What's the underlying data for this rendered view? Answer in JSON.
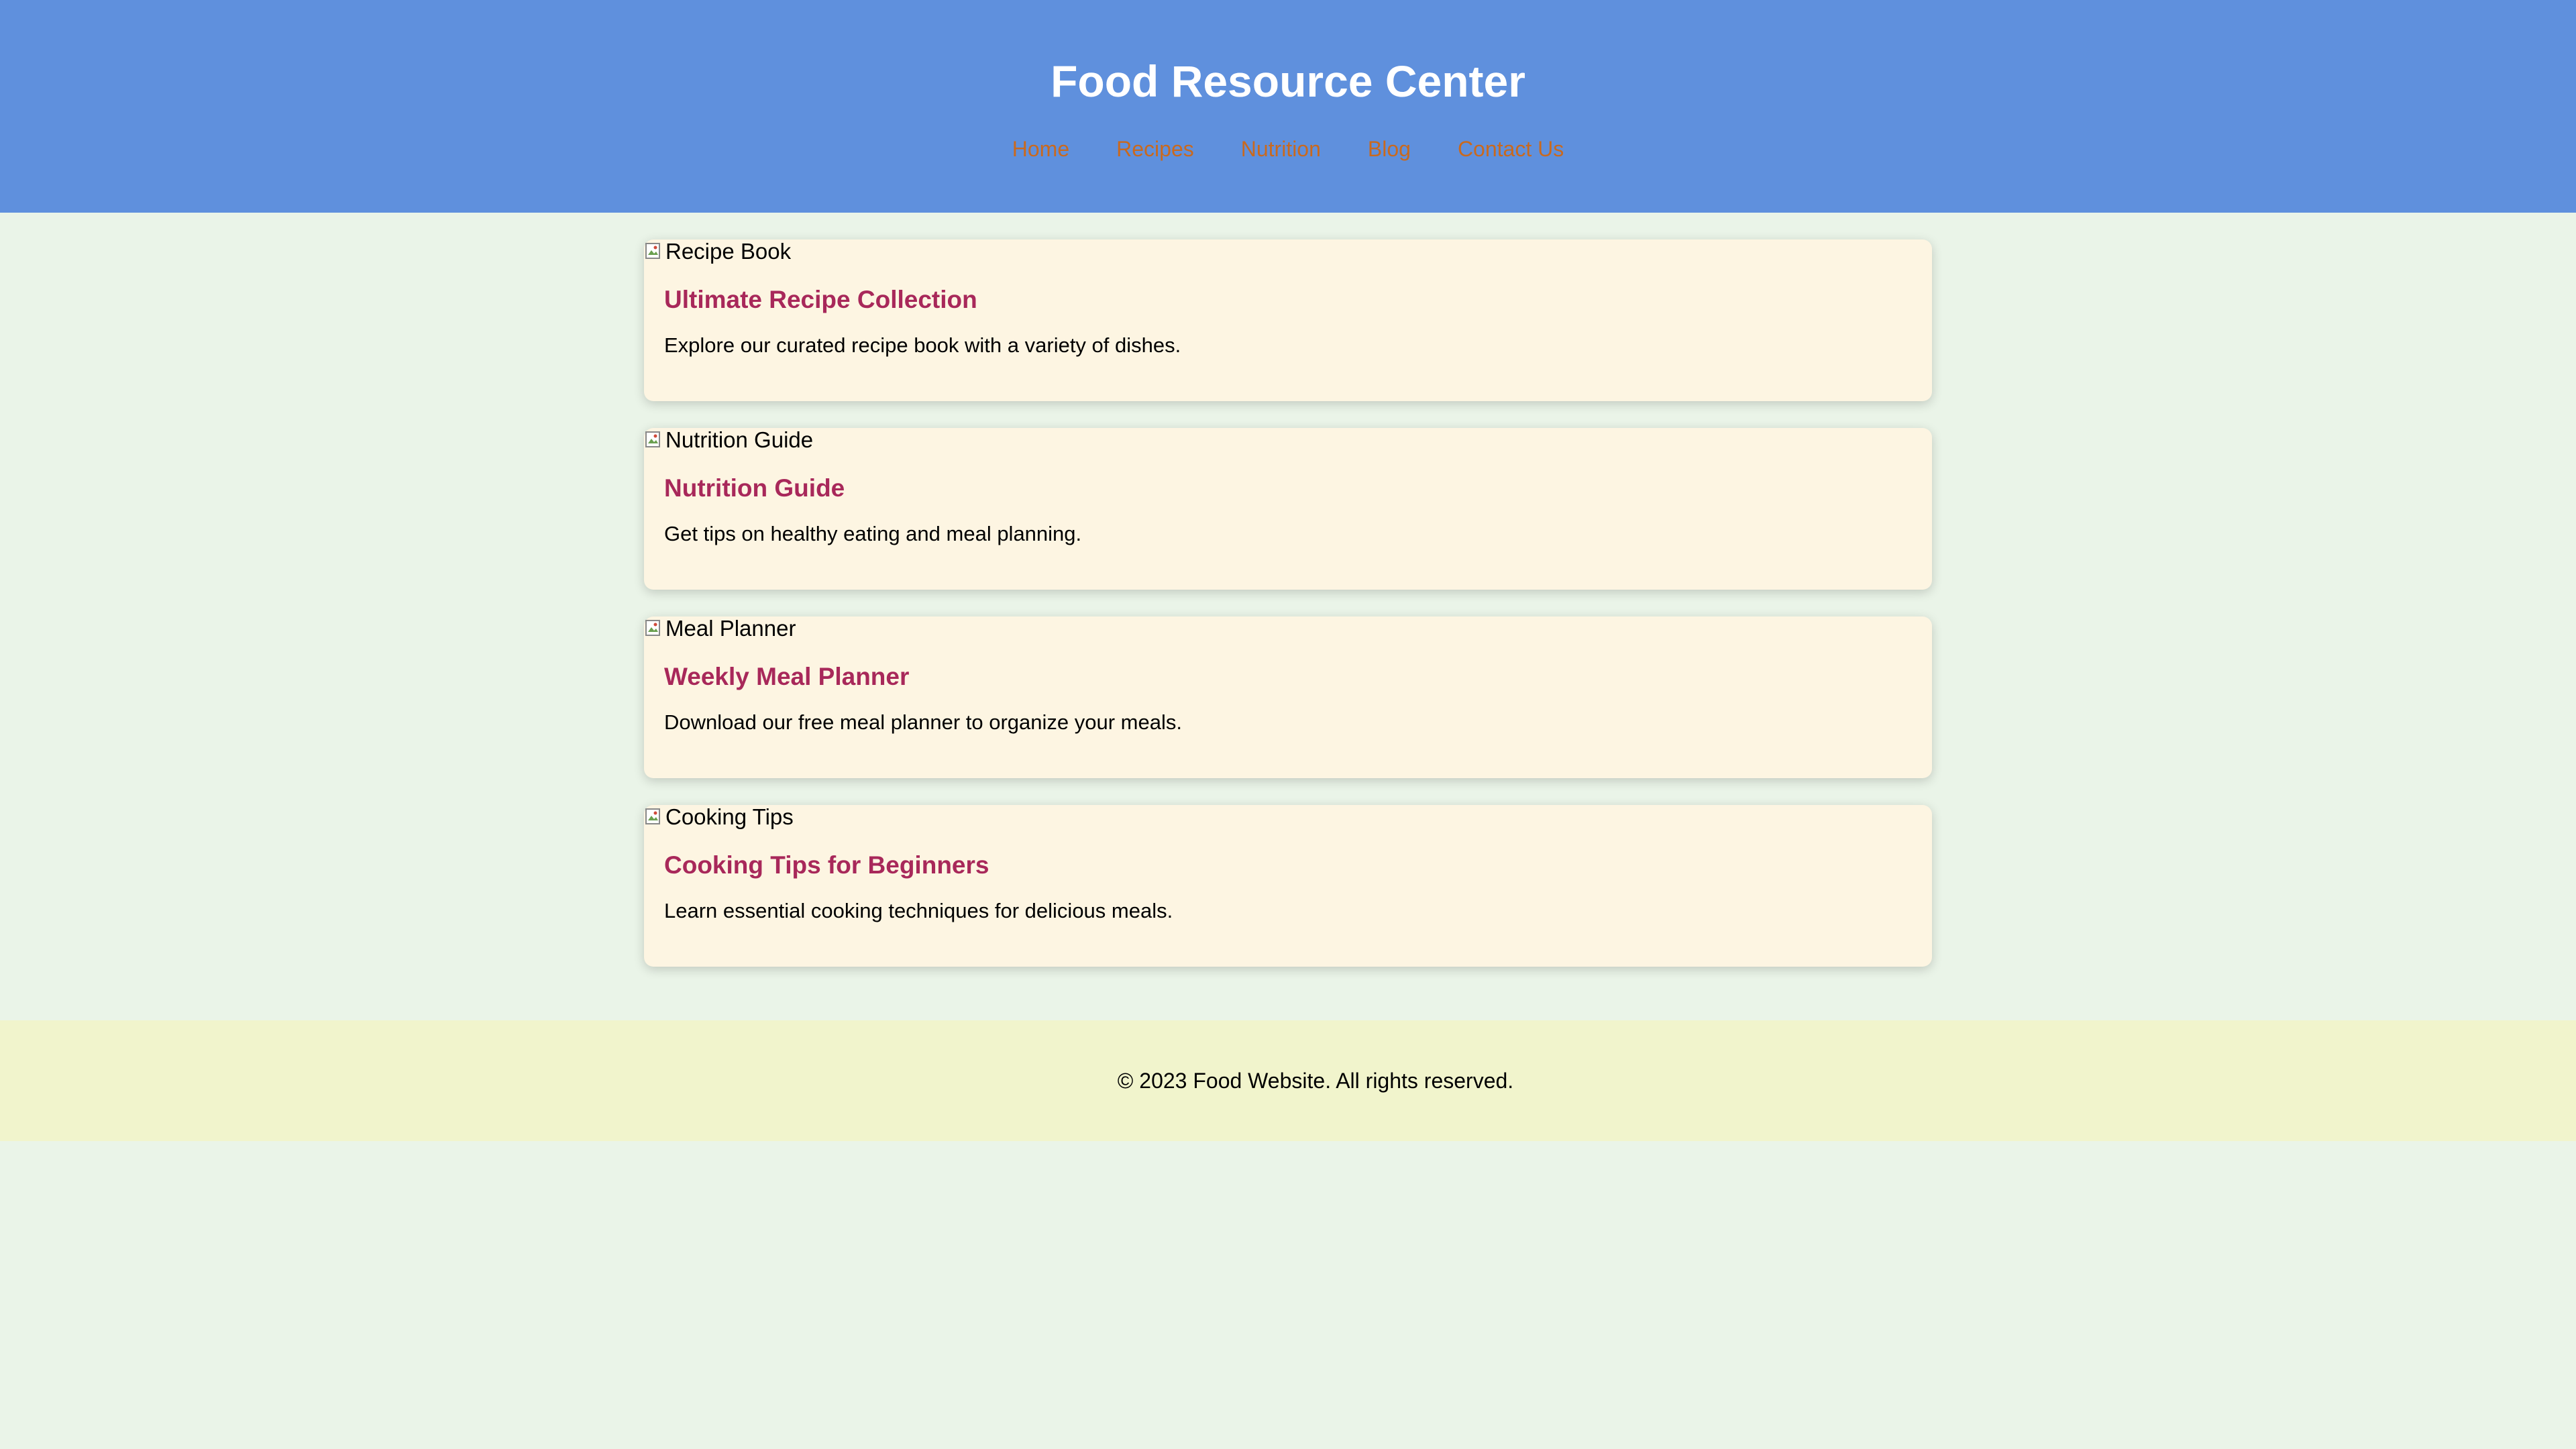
{
  "header": {
    "title": "Food Resource Center",
    "nav": [
      {
        "label": "Home"
      },
      {
        "label": "Recipes"
      },
      {
        "label": "Nutrition"
      },
      {
        "label": "Blog"
      },
      {
        "label": "Contact Us"
      }
    ],
    "nav_color": "#c9691e",
    "background": "#5f90dd"
  },
  "cards": [
    {
      "image_alt": "Recipe Book",
      "title": "Ultimate Recipe Collection",
      "description": "Explore our curated recipe book with a variety of dishes."
    },
    {
      "image_alt": "Nutrition Guide",
      "title": "Nutrition Guide",
      "description": "Get tips on healthy eating and meal planning."
    },
    {
      "image_alt": "Meal Planner",
      "title": "Weekly Meal Planner",
      "description": "Download our free meal planner to organize your meals."
    },
    {
      "image_alt": "Cooking Tips",
      "title": "Cooking Tips for Beginners",
      "description": "Learn essential cooking techniques for delicious meals."
    }
  ],
  "footer": {
    "copyright": "© 2023 Food Website. All rights reserved."
  },
  "colors": {
    "page_background": "#eaf4e8",
    "card_background": "#fdf5e2",
    "card_title": "#a8285a",
    "footer_background": "#f1f4cc"
  }
}
